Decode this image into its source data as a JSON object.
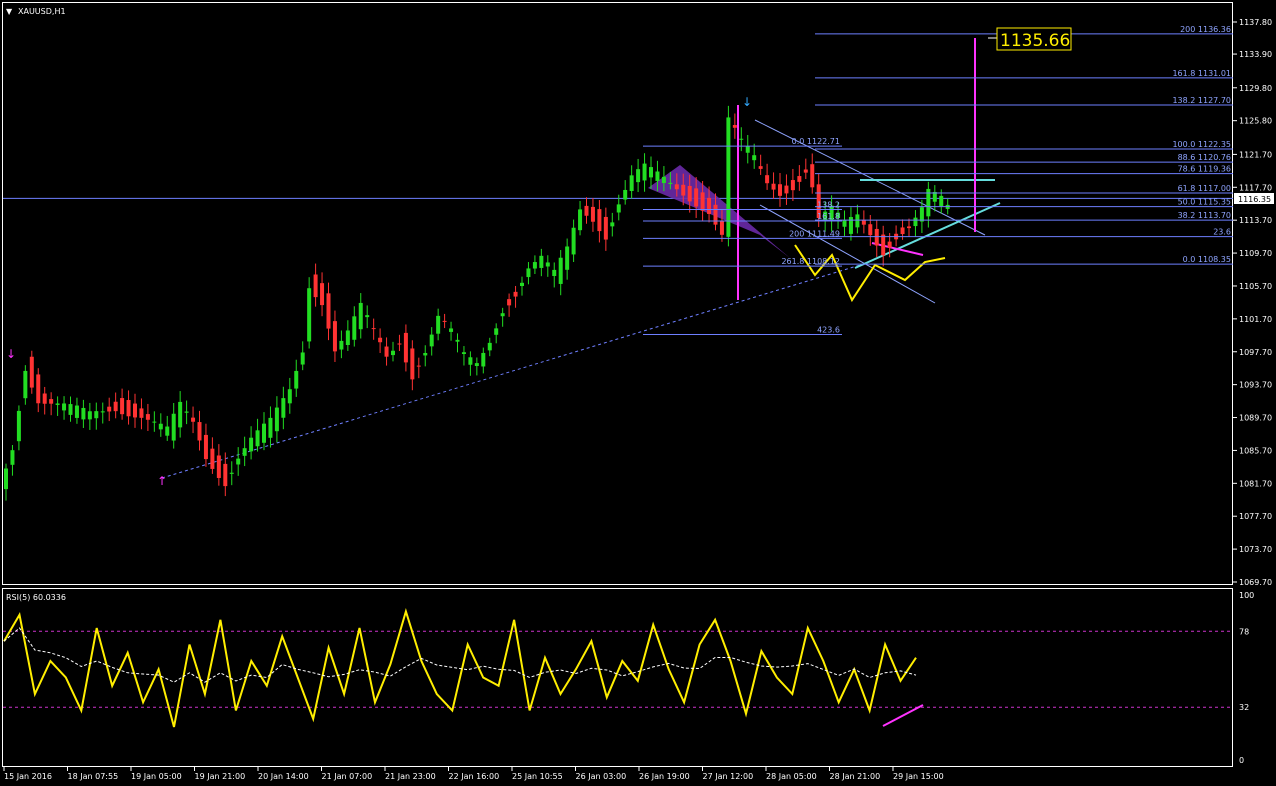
{
  "window": {
    "symbol_label": "XAUUSD,H1",
    "rsi_label": "RSI(5) 60.0336",
    "target_label": "1135.66",
    "current_price": "1116.35"
  },
  "colors": {
    "background": "#000000",
    "bull": "#22dd22",
    "bear": "#ff3333",
    "grid": "#ffffff",
    "fib": "#6e7fff",
    "rsi": "#ffee00",
    "pattern": "#ffee00",
    "target_line": "#ff33ff",
    "trendline": "#66dddd",
    "support": "#6e7fff"
  },
  "chart_data": {
    "type": "candlestick",
    "y_ticks": [
      "1137.80",
      "1133.90",
      "1129.80",
      "1125.80",
      "1121.70",
      "1117.70",
      "1113.70",
      "1109.70",
      "1105.70",
      "1101.70",
      "1097.70",
      "1093.70",
      "1089.70",
      "1085.70",
      "1081.70",
      "1077.70",
      "1073.70",
      "1069.70"
    ],
    "ylim": [
      1069.7,
      1137.8
    ],
    "x_ticks": [
      "15 Jan 2016",
      "18 Jan 07:55",
      "19 Jan 05:00",
      "19 Jan 21:00",
      "20 Jan 14:00",
      "21 Jan 07:00",
      "21 Jan 23:00",
      "22 Jan 16:00",
      "25 Jan 10:55",
      "26 Jan 03:00",
      "26 Jan 19:00",
      "27 Jan 12:00",
      "28 Jan 05:00",
      "28 Jan 21:00",
      "29 Jan 15:00"
    ],
    "price_path": [
      [
        0,
        1081
      ],
      [
        2,
        1086
      ],
      [
        4,
        1096
      ],
      [
        6,
        1092
      ],
      [
        10,
        1091
      ],
      [
        14,
        1090
      ],
      [
        18,
        1091
      ],
      [
        22,
        1090
      ],
      [
        26,
        1088
      ],
      [
        28,
        1091
      ],
      [
        30,
        1089
      ],
      [
        32,
        1085
      ],
      [
        34,
        1083
      ],
      [
        35,
        1082
      ],
      [
        37,
        1085
      ],
      [
        39,
        1087
      ],
      [
        42,
        1089
      ],
      [
        45,
        1093
      ],
      [
        47,
        1098
      ],
      [
        48,
        1106
      ],
      [
        50,
        1104
      ],
      [
        52,
        1098
      ],
      [
        54,
        1100
      ],
      [
        56,
        1103
      ],
      [
        58,
        1100
      ],
      [
        60,
        1097
      ],
      [
        62,
        1099
      ],
      [
        64,
        1095
      ],
      [
        66,
        1098
      ],
      [
        68,
        1102
      ],
      [
        70,
        1100
      ],
      [
        72,
        1097
      ],
      [
        74,
        1096
      ],
      [
        76,
        1099
      ],
      [
        78,
        1103
      ],
      [
        80,
        1105
      ],
      [
        82,
        1108
      ],
      [
        84,
        1109
      ],
      [
        86,
        1107
      ],
      [
        88,
        1110
      ],
      [
        90,
        1115
      ],
      [
        92,
        1114
      ],
      [
        94,
        1112
      ],
      [
        96,
        1116
      ],
      [
        98,
        1119
      ],
      [
        100,
        1120
      ],
      [
        102,
        1119
      ],
      [
        104,
        1118
      ],
      [
        106,
        1117
      ],
      [
        108,
        1116
      ],
      [
        110,
        1115
      ],
      [
        112,
        1112
      ],
      [
        113,
        1126
      ],
      [
        115,
        1123
      ],
      [
        117,
        1121
      ],
      [
        119,
        1118
      ],
      [
        121,
        1117
      ],
      [
        123,
        1118
      ],
      [
        125,
        1120
      ],
      [
        126,
        1118
      ],
      [
        127,
        1114
      ],
      [
        129,
        1115
      ],
      [
        131,
        1113
      ],
      [
        133,
        1114
      ],
      [
        135,
        1112
      ],
      [
        137,
        1110
      ],
      [
        139,
        1112
      ],
      [
        141,
        1113
      ],
      [
        143,
        1115
      ],
      [
        144,
        1117
      ],
      [
        146,
        1116
      ],
      [
        147,
        1115
      ]
    ],
    "fib_right": [
      {
        "label": "200 1136.36",
        "price": 1136.36
      },
      {
        "label": "161.8 1131.01",
        "price": 1131.01
      },
      {
        "label": "138.2 1127.70",
        "price": 1127.7
      },
      {
        "label": "100.0 1122.35",
        "price": 1122.35
      },
      {
        "label": "88.6 1120.76",
        "price": 1120.76
      },
      {
        "label": "78.6 1119.36",
        "price": 1119.36
      },
      {
        "label": "61.8 1117.00",
        "price": 1117.0
      },
      {
        "label": "50.0 1115.35",
        "price": 1115.35
      },
      {
        "label": "38.2 1113.70",
        "price": 1113.7
      },
      {
        "label": "23.6",
        "price": 1111.7
      },
      {
        "label": "0.0 1108.35",
        "price": 1108.35
      }
    ],
    "fib_left": [
      {
        "label": "0.0 1122.71",
        "price": 1122.71
      },
      {
        "label": "138.2",
        "price": 1115.0
      },
      {
        "label": "161.8",
        "price": 1113.6
      },
      {
        "label": "200 1111.49",
        "price": 1111.49
      },
      {
        "label": "261.8 1108.12",
        "price": 1108.12
      },
      {
        "label": "423.6",
        "price": 1099.8
      }
    ],
    "rsi": {
      "label": "RSI(5) 60.0336",
      "levels": [
        "100",
        "78",
        "32",
        "0"
      ],
      "values": [
        72,
        88,
        40,
        60,
        50,
        30,
        80,
        45,
        65,
        35,
        55,
        20,
        70,
        40,
        85,
        30,
        60,
        45,
        75,
        50,
        25,
        68,
        40,
        80,
        35,
        58,
        90,
        60,
        40,
        30,
        70,
        50,
        45,
        85,
        30,
        62,
        40,
        55,
        72,
        38,
        60,
        48,
        82,
        55,
        35,
        70,
        85,
        60,
        28,
        66,
        50,
        40,
        80,
        60,
        35,
        55,
        30,
        70,
        48,
        62
      ]
    }
  }
}
